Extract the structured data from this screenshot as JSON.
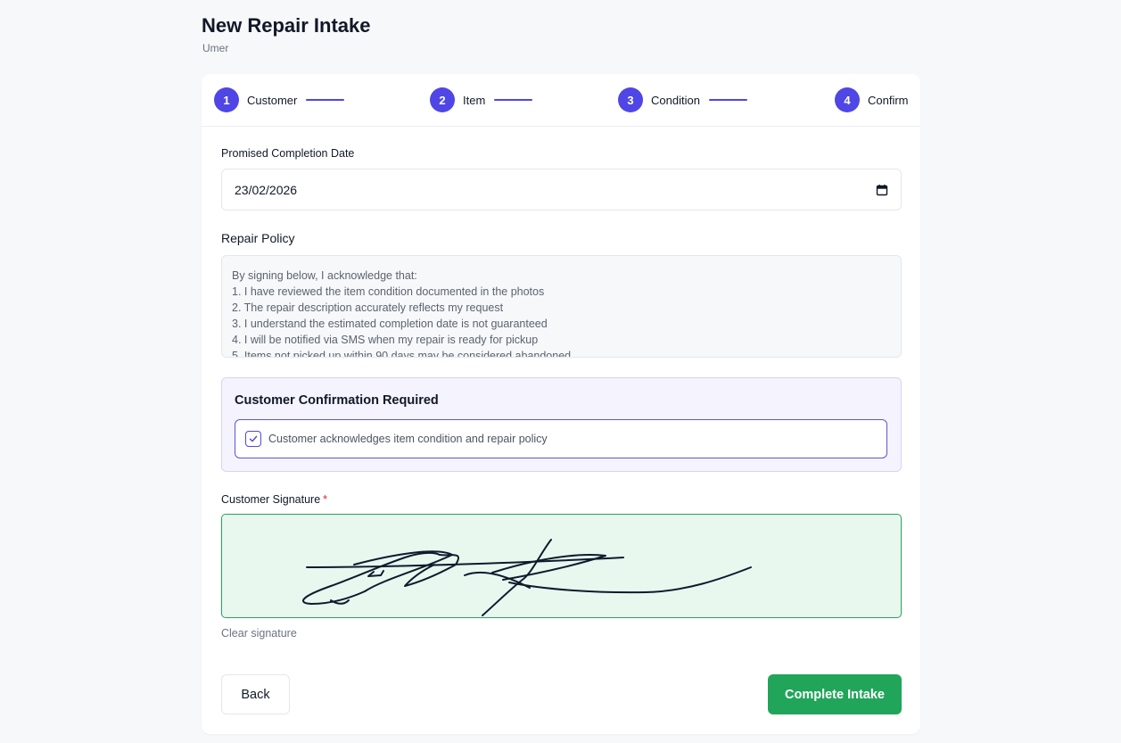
{
  "header": {
    "title": "New Repair Intake",
    "subtitle": "Umer"
  },
  "stepper": {
    "accent_color": "#4f46e5",
    "steps": [
      {
        "number": "1",
        "label": "Customer"
      },
      {
        "number": "2",
        "label": "Item"
      },
      {
        "number": "3",
        "label": "Condition"
      },
      {
        "number": "4",
        "label": "Confirm"
      }
    ]
  },
  "completion_date": {
    "label": "Promised Completion Date",
    "value": "23/02/2026",
    "icon": "calendar-icon"
  },
  "policy": {
    "title": "Repair Policy",
    "lines": [
      "By signing below, I acknowledge that:",
      "1. I have reviewed the item condition documented in the photos",
      "2. The repair description accurately reflects my request",
      "3. I understand the estimated completion date is not guaranteed",
      "4. I will be notified via SMS when my repair is ready for pickup",
      "5. Items not picked up within 90 days may be considered abandoned"
    ]
  },
  "confirmation": {
    "title": "Customer Confirmation Required",
    "checkbox_label": "Customer acknowledges item condition and repair policy",
    "checked": true
  },
  "signature": {
    "label": "Customer Signature",
    "required_mark": "*",
    "clear_label": "Clear signature",
    "status_color": "#21a55a"
  },
  "actions": {
    "back_label": "Back",
    "complete_label": "Complete Intake",
    "complete_color": "#21a55a"
  }
}
